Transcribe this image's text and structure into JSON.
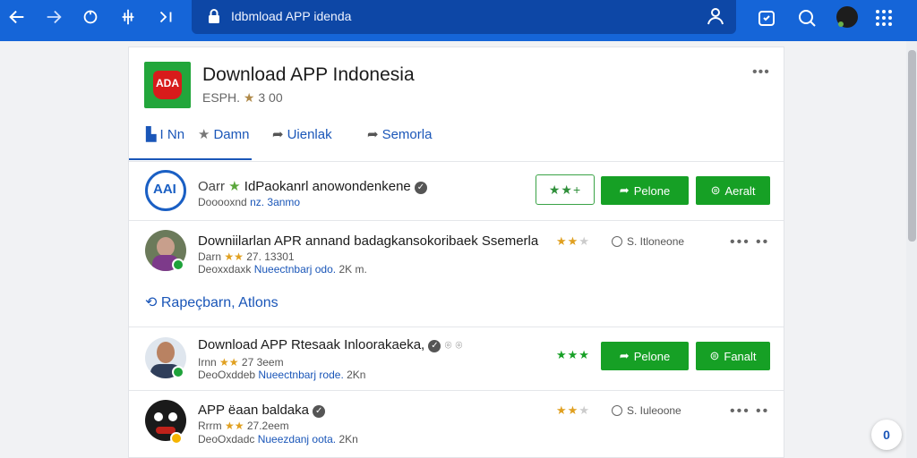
{
  "browser": {
    "url_text": "Idbmload APP idenda",
    "nav_icons": [
      "back-arrow-icon",
      "forward-arrow-icon",
      "refresh-icon",
      "split-icon",
      "collapse-icon"
    ],
    "right_icons": [
      "person-icon",
      "shield-icon",
      "search-icon",
      "avatar",
      "grid-icon"
    ]
  },
  "app": {
    "title": "Download APP Indonesia",
    "subtitle_prefix": "ESPH.",
    "subtitle_rating": "3 00",
    "icon_text": "ADA",
    "tabs": [
      {
        "label": "I Nn",
        "icon": "thumb-icon"
      },
      {
        "label": "Damn",
        "icon": "star-icon"
      },
      {
        "label": "Uienlak",
        "icon": "share-icon"
      },
      {
        "label": "Semorla",
        "icon": "share-icon"
      }
    ]
  },
  "rows": [
    {
      "title_prefix": "Oarr",
      "title": "IdPaokanrl anowondenkene",
      "meta": "Dooooxnd",
      "meta_link": "nz. 3anmo",
      "buttons": {
        "rating": "★★+",
        "primary": "Pelone",
        "secondary": "Aeralt"
      }
    },
    {
      "title": "Downiilarlan APR annand badagkansokoribaek Ssemerla",
      "meta": "Darn",
      "meta_rating": "27. 13301",
      "meta2_prefix": "Deoxxdaxk",
      "meta2_link": "Nueectnbarj odo.",
      "meta2_suffix": "2K m.",
      "status": "S. Itloneone"
    },
    {
      "title": "Download APP Rtesaak Inloorakaeka,",
      "meta": "Irnn",
      "meta_rating": "27 3eem",
      "meta2_prefix": "DeoOxddeb",
      "meta2_link": "Nueectnbarj rode.",
      "meta2_suffix": "2Kn",
      "buttons": {
        "primary": "Pelone",
        "secondary": "Fanalt"
      }
    },
    {
      "title": "APP ëaan baldaka",
      "meta": "Rrrm",
      "meta_rating": "27.2eem",
      "meta2_prefix": "DeoOxdadc",
      "meta2_link": "Nueezdanj oota.",
      "meta2_suffix": "2Kn",
      "status": "S. Iuleoone"
    }
  ],
  "section": {
    "title": "Rapeçbarn, Atlons"
  },
  "help": {
    "label": "0"
  }
}
